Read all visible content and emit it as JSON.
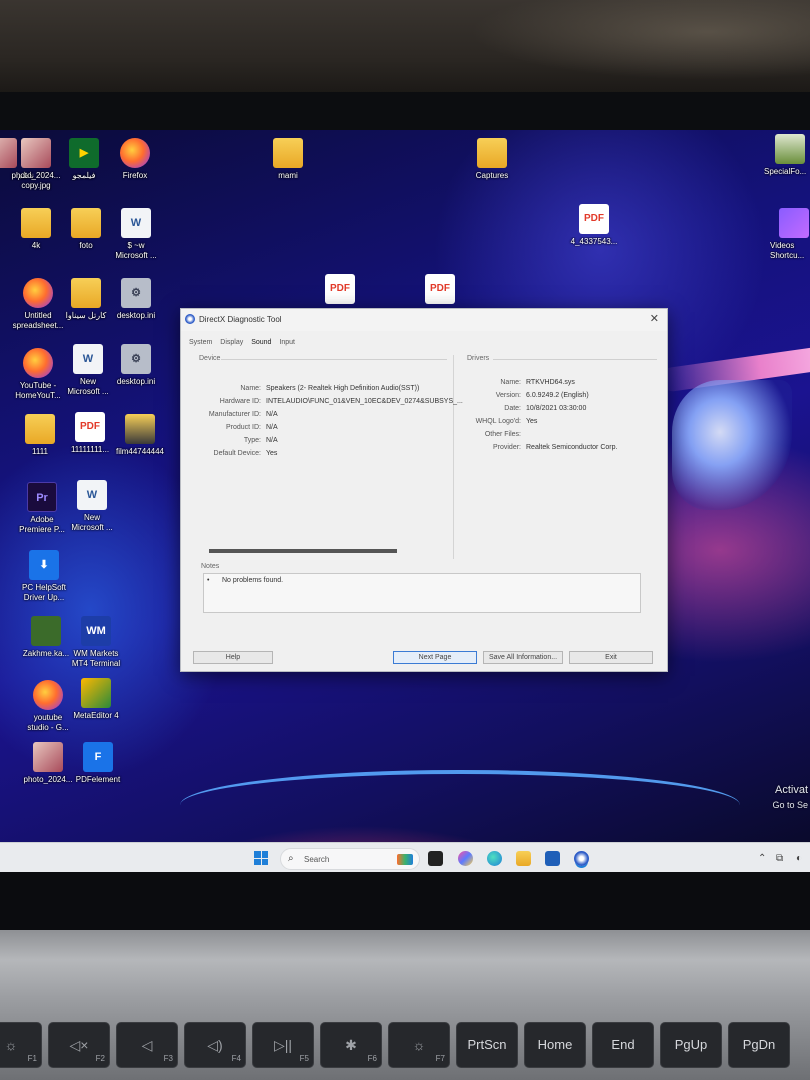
{
  "desktop_icons": [
    {
      "label": "ناظم",
      "glyph": ""
    },
    {
      "label": "photo_2024...",
      "label2": "copy.jpg",
      "glyph": ""
    },
    {
      "label": "فيلمجو",
      "glyph": ""
    },
    {
      "label": "Firefox",
      "glyph": ""
    },
    {
      "label": "mami",
      "glyph": ""
    },
    {
      "label": "Captures",
      "glyph": ""
    },
    {
      "label": "SpecialFo...",
      "glyph": ""
    },
    {
      "label": "4k",
      "glyph": ""
    },
    {
      "label": "foto",
      "glyph": ""
    },
    {
      "label": "$ ~w",
      "label2": "Microsoft ...",
      "glyph": "W"
    },
    {
      "label": "4_4337543...",
      "glyph": "PDF"
    },
    {
      "label": "Videos",
      "label2": "Shortcu...",
      "glyph": ""
    },
    {
      "label": "Untitled",
      "label2": "spreadsheet...",
      "glyph": ""
    },
    {
      "label": "کارتل سیناوا",
      "glyph": ""
    },
    {
      "label": "desktop.ini",
      "glyph": ""
    },
    {
      "label": "YouTube -",
      "label2": "HomeYouT...",
      "glyph": ""
    },
    {
      "label": "New",
      "label2": "Microsoft ...",
      "glyph": "W"
    },
    {
      "label": "desktop.ini",
      "glyph": ""
    },
    {
      "label": "1111",
      "glyph": ""
    },
    {
      "label": "11111111...",
      "glyph": "PDF"
    },
    {
      "label": "film44744444",
      "glyph": ""
    },
    {
      "label": "Adobe",
      "label2": "Premiere P...",
      "glyph": "Pr"
    },
    {
      "label": "New",
      "label2": "Microsoft ...",
      "glyph": "W"
    },
    {
      "label": "PC HelpSoft",
      "label2": "Driver Up...",
      "glyph": ""
    },
    {
      "label": "Zakhme.ka...",
      "glyph": ""
    },
    {
      "label": "WM Markets",
      "label2": "MT4 Terminal",
      "glyph": "WM"
    },
    {
      "label": "youtube",
      "label2": "studio - G...",
      "glyph": ""
    },
    {
      "label": "MetaEditor 4",
      "glyph": ""
    },
    {
      "label": "photo_2024...",
      "glyph": ""
    },
    {
      "label": "PDFelement",
      "glyph": ""
    },
    {
      "label": "PDF",
      "glyph": "PDF"
    },
    {
      "label": "PDF",
      "glyph": "PDF"
    }
  ],
  "dialog": {
    "title": "DirectX Diagnostic Tool",
    "close": "✕",
    "tabs": [
      "System",
      "Display",
      "Sound",
      "Input"
    ],
    "device_section": "Device",
    "drivers_section": "Drivers",
    "device_fields": [
      {
        "key": "Name:",
        "value": "Speakers (2- Realtek High Definition Audio(SST))"
      },
      {
        "key": "Hardware ID:",
        "value": "INTELAUDIO\\FUNC_01&VEN_10EC&DEV_0274&SUBSYS_..."
      },
      {
        "key": "Manufacturer ID:",
        "value": "N/A"
      },
      {
        "key": "Product ID:",
        "value": "N/A"
      },
      {
        "key": "Type:",
        "value": "N/A"
      },
      {
        "key": "Default Device:",
        "value": "Yes"
      }
    ],
    "driver_fields": [
      {
        "key": "Name:",
        "value": "RTKVHD64.sys"
      },
      {
        "key": "Version:",
        "value": "6.0.9249.2 (English)"
      },
      {
        "key": "Date:",
        "value": "10/8/2021 03:30:00"
      },
      {
        "key": "WHQL Logo'd:",
        "value": "Yes"
      },
      {
        "key": "Other Files:",
        "value": ""
      },
      {
        "key": "Provider:",
        "value": "Realtek Semiconductor Corp."
      }
    ],
    "notes_label": "Notes",
    "notes": [
      "No problems found."
    ],
    "buttons": {
      "help": "Help",
      "next": "Next Page",
      "save": "Save All Information...",
      "exit": "Exit"
    }
  },
  "taskbar": {
    "search_placeholder": "Search",
    "search_icon": "search-icon",
    "apps": [
      "file-explorer-icon",
      "edge-icon",
      "folder-icon",
      "store-icon",
      "directx-icon"
    ]
  },
  "activation": {
    "line1": "Activat",
    "line2": "Go to Se"
  },
  "keyboard": {
    "keys": [
      "F1",
      "F2",
      "F3",
      "F4",
      "F5",
      "F6",
      "F7",
      "PrtScn",
      "Home",
      "End",
      "PgUp",
      "PgDn"
    ]
  },
  "colors": {
    "accent": "#1f7fd8",
    "dialog_bg": "#f0f0f0",
    "wallpaper": "#14127a"
  }
}
